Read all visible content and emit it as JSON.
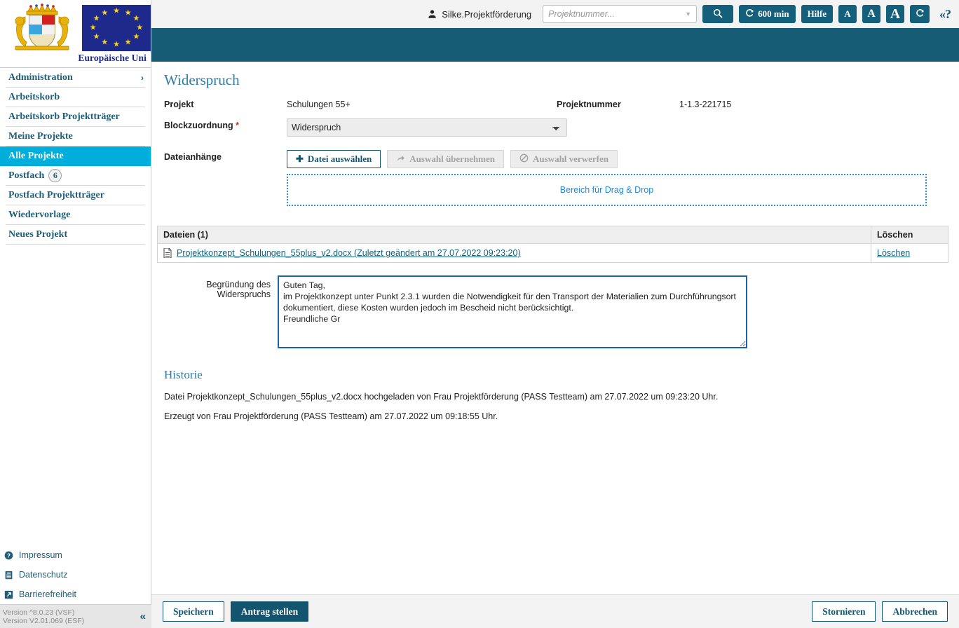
{
  "brand": {
    "eu_label": "Europäische Uni",
    "crest_alt": "bavaria-coat-of-arms",
    "eu_flag_alt": "eu-flag"
  },
  "topbar": {
    "user_icon": "user-icon",
    "user_name": "Silke.Projektförderung",
    "search_placeholder": "Projektnummer...",
    "search_value": "",
    "search_button_icon": "search-icon",
    "session_timer": "600 min",
    "session_timer_icon": "refresh-icon",
    "help_label": "Hilfe",
    "font_small": "A",
    "font_medium": "A",
    "font_large": "A",
    "reload_icon": "refresh-icon",
    "help_toggle": "«?"
  },
  "sidebar": {
    "items": [
      {
        "label": "Administration",
        "chevron": "›",
        "active": false,
        "badge": null
      },
      {
        "label": "Arbeitskorb",
        "chevron": "",
        "active": false,
        "badge": null
      },
      {
        "label": "Arbeitskorb Projektträger",
        "chevron": "",
        "active": false,
        "badge": null
      },
      {
        "label": "Meine Projekte",
        "chevron": "",
        "active": false,
        "badge": null
      },
      {
        "label": "Alle Projekte",
        "chevron": "",
        "active": true,
        "badge": null
      },
      {
        "label": "Postfach",
        "chevron": "",
        "active": false,
        "badge": "6"
      },
      {
        "label": "Postfach Projektträger",
        "chevron": "",
        "active": false,
        "badge": null
      },
      {
        "label": "Wiedervorlage",
        "chevron": "",
        "active": false,
        "badge": null
      },
      {
        "label": "Neues Projekt",
        "chevron": "",
        "active": false,
        "badge": null
      }
    ],
    "bottom_links": [
      {
        "label": "Impressum",
        "icon": "question-circle-icon"
      },
      {
        "label": "Datenschutz",
        "icon": "privacy-document-icon"
      },
      {
        "label": "Barrierefreiheit",
        "icon": "accessibility-arrow-icon"
      }
    ],
    "version_line_1": "Version ^8.0.23 (VSF)",
    "version_line_2": "Version V2.01.069 (ESF)",
    "collapse_icon": "«"
  },
  "main": {
    "page_title": "Widerspruch",
    "projekt_label": "Projekt",
    "projekt_value": "Schulungen 55+",
    "projektnummer_label": "Projektnummer",
    "projektnummer_value": "1-1.3-221715",
    "blockzuordnung_label": "Blockzuordnung",
    "blockzuordnung_required": "*",
    "blockzuordnung_value": "Widerspruch",
    "blockzuordnung_options": [
      "Widerspruch"
    ],
    "dateianhaenge_label": "Dateianhänge",
    "btn_datei_auswaehlen": "Datei auswählen",
    "btn_datei_auswaehlen_icon": "plus-icon",
    "btn_auswahl_uebernehmen": "Auswahl übernehmen",
    "btn_auswahl_uebernehmen_icon": "share-arrow-icon",
    "btn_auswahl_verwerfen": "Auswahl verwerfen",
    "btn_auswahl_verwerfen_icon": "no-entry-icon",
    "dropzone_text": "Bereich für Drag & Drop",
    "files_table": {
      "header_files": "Dateien (1)",
      "header_delete": "Löschen",
      "rows": [
        {
          "icon": "document-icon",
          "name": "Projektkonzept_Schulungen_55plus_v2.docx (Zuletzt geändert am 27.07.2022 09:23:20)",
          "delete_label": "Löschen"
        }
      ]
    },
    "reason_label": "Begründung des Widerspruchs",
    "reason_value": "Guten Tag,\nim Projektkonzept unter Punkt 2.3.1 wurden die Notwendigkeit für den Transport der Materialien zum Durchführungsort dokumentiert, diese Kosten wurden jedoch im Bescheid nicht berücksichtigt.\nFreundliche Gr",
    "history_title": "Historie",
    "history_lines": [
      "Datei Projektkonzept_Schulungen_55plus_v2.docx hochgeladen von Frau Projektförderung (PASS Testteam) am 27.07.2022 um 09:23:20 Uhr.",
      "Erzeugt von Frau Projektförderung (PASS Testteam) am 27.07.2022 um 09:18:55 Uhr."
    ]
  },
  "footer": {
    "speichern": "Speichern",
    "antrag_stellen": "Antrag stellen",
    "stornieren": "Stornieren",
    "abbrechen": "Abbrechen"
  },
  "colors": {
    "teal": "#165c74",
    "accent_cyan": "#00aedb",
    "link_blue": "#17607d",
    "heading_blue": "#2b7ca8",
    "required_red": "#c0392b",
    "dropzone_blue": "#3a8dcc"
  }
}
